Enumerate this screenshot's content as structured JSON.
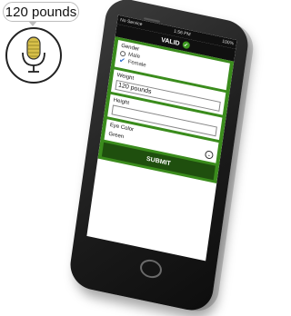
{
  "speech_bubble": {
    "text": "120 pounds"
  },
  "status_bar": {
    "carrier": "No Service",
    "time": "1:56 PM",
    "battery": "100%"
  },
  "nav": {
    "title": "VALID",
    "check_glyph": "✓"
  },
  "form": {
    "gender": {
      "label": "Gender",
      "options": [
        "Male",
        "Female"
      ],
      "selected": "Female"
    },
    "weight": {
      "label": "Weight",
      "value": "120 pounds"
    },
    "height": {
      "label": "Height",
      "value": ""
    },
    "eye_color": {
      "label": "Eye Color",
      "value": "Green"
    },
    "submit_label": "SUBMIT"
  },
  "icons": {
    "mic": "microphone-icon",
    "check": "check-icon",
    "chevron": "chevron-down-icon"
  },
  "colors": {
    "accent_green": "#3a8c1c",
    "submit_green": "#1f4f0e",
    "check_blue": "#2f6fd0"
  }
}
